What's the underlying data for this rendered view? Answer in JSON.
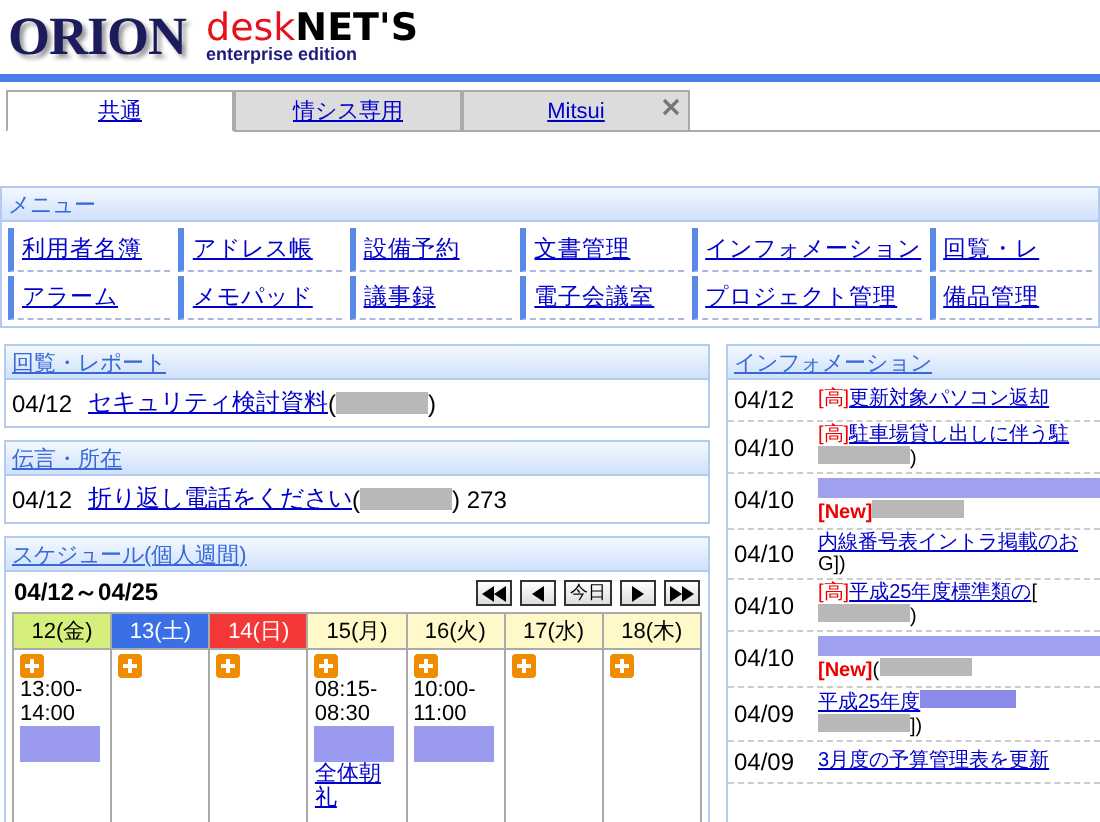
{
  "logo": {
    "company": "ORION",
    "product_red": "desk",
    "product_black": "NET'S",
    "edition": "enterprise edition"
  },
  "tabs": [
    {
      "label": "共通",
      "selected": true,
      "closable": false
    },
    {
      "label": "情シス専用",
      "selected": false,
      "closable": false
    },
    {
      "label": "Mitsui",
      "selected": false,
      "closable": true
    }
  ],
  "menu": {
    "title": "メニュー",
    "items": [
      "利用者名簿",
      "アドレス帳",
      "設備予約",
      "文書管理",
      "インフォメーション",
      "回覧・レ",
      "アラーム",
      "メモパッド",
      "議事録",
      "電子会議室",
      "プロジェクト管理",
      "備品管理"
    ]
  },
  "circulation": {
    "title": "回覧・レポート",
    "rows": [
      {
        "date": "04/12",
        "parts": [
          {
            "kind": "link",
            "text": "セキュリティ検討資料"
          },
          {
            "kind": "text",
            "text": "("
          },
          {
            "kind": "blur-text"
          },
          {
            "kind": "text",
            "text": ")"
          }
        ]
      }
    ]
  },
  "messages": {
    "title": "伝言・所在",
    "rows": [
      {
        "date": "04/12",
        "parts": [
          {
            "kind": "link",
            "text": "折り返し電話をください"
          },
          {
            "kind": "text",
            "text": "("
          },
          {
            "kind": "blur-text"
          },
          {
            "kind": "text",
            "text": ") 273"
          }
        ]
      }
    ]
  },
  "schedule": {
    "title": "スケジュール(個人週間)",
    "range": "04/12～04/25",
    "today_button": "今日",
    "days": [
      {
        "label": "12(金)",
        "kind": "today",
        "events": [
          {
            "time": "13:00-14:00",
            "parts": [
              {
                "kind": "blur-link"
              }
            ]
          }
        ]
      },
      {
        "label": "13(土)",
        "kind": "saturday"
      },
      {
        "label": "14(日)",
        "kind": "sunday"
      },
      {
        "label": "15(月)",
        "kind": "weekday",
        "events": [
          {
            "time": "08:15-08:30",
            "parts": [
              {
                "kind": "blur-link"
              },
              {
                "kind": "link",
                "text": "全体朝礼"
              }
            ]
          }
        ]
      },
      {
        "label": "16(火)",
        "kind": "weekday",
        "events": [
          {
            "time": "10:00-11:00",
            "parts": [
              {
                "kind": "blur-link"
              }
            ]
          }
        ]
      },
      {
        "label": "17(水)",
        "kind": "weekday"
      },
      {
        "label": "18(木)",
        "kind": "weekday"
      }
    ]
  },
  "information": {
    "title": "インフォメーション",
    "rows": [
      {
        "date": "04/12",
        "parts": [
          {
            "kind": "priority",
            "text": "[高]"
          },
          {
            "kind": "link",
            "text": "更新対象パソコン返却"
          }
        ]
      },
      {
        "date": "04/10",
        "parts": [
          {
            "kind": "priority",
            "text": "[高]"
          },
          {
            "kind": "link",
            "text": "駐車場貸し出しに伴う駐"
          },
          {
            "kind": "blur-text"
          },
          {
            "kind": "text",
            "text": ")"
          }
        ]
      },
      {
        "date": "04/10",
        "parts": [
          {
            "kind": "blur-link-long"
          },
          {
            "kind": "new",
            "text": "[New]"
          },
          {
            "kind": "blur-text"
          }
        ]
      },
      {
        "date": "04/10",
        "parts": [
          {
            "kind": "link",
            "text": "内線番号表イントラ掲載のお"
          },
          {
            "kind": "text",
            "text": "G])"
          }
        ]
      },
      {
        "date": "04/10",
        "parts": [
          {
            "kind": "priority",
            "text": "[高]"
          },
          {
            "kind": "link",
            "text": "平成25年度標準類の"
          },
          {
            "kind": "text",
            "text": "["
          },
          {
            "kind": "blur-text"
          },
          {
            "kind": "text",
            "text": ")"
          }
        ]
      },
      {
        "date": "04/10",
        "parts": [
          {
            "kind": "blur-link-long"
          },
          {
            "kind": "new",
            "text": "[New]"
          },
          {
            "kind": "text",
            "text": "("
          },
          {
            "kind": "blur-text"
          }
        ]
      },
      {
        "date": "04/09",
        "parts": [
          {
            "kind": "link",
            "text": "平成25年度"
          },
          {
            "kind": "blur-link"
          },
          {
            "kind": "blur-text"
          },
          {
            "kind": "text",
            "text": "])"
          }
        ]
      },
      {
        "date": "04/09",
        "parts": [
          {
            "kind": "link",
            "text": "3月度の予算管理表を更新"
          }
        ]
      }
    ]
  }
}
